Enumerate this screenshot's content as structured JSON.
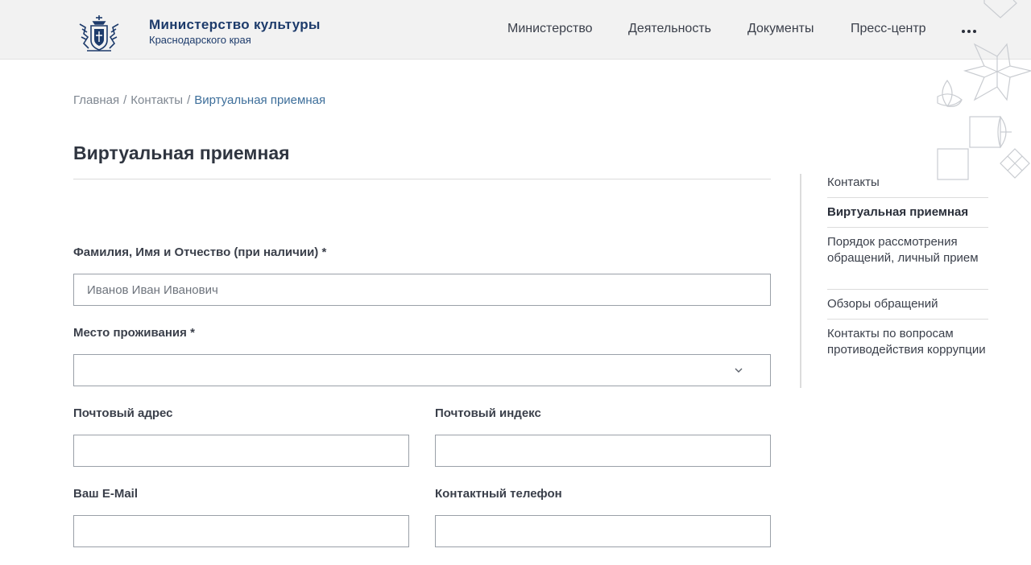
{
  "header": {
    "brand_title": "Министерство культуры",
    "brand_subtitle": "Краснодарского края",
    "nav": [
      "Министерство",
      "Деятельность",
      "Документы",
      "Пресс-центр"
    ]
  },
  "breadcrumb": {
    "home": "Главная",
    "contacts": "Контакты",
    "current": "Виртуальная приемная",
    "separator": "/"
  },
  "page": {
    "title": "Виртуальная приемная"
  },
  "form": {
    "fio_label": "Фамилия, Имя и Отчество (при наличии) *",
    "fio_placeholder": "Иванов Иван Иванович",
    "residence_label": "Место проживания *",
    "residence_value": "",
    "address_label": "Почтовый адрес",
    "index_label": "Почтовый индекс",
    "email_label": "Ваш E-Mail",
    "phone_label": "Контактный телефон"
  },
  "sidebar": {
    "items": [
      "Контакты",
      "Виртуальная приемная",
      "Порядок рассмотрения обращений, личный прием",
      "Обзоры обращений",
      "Контакты по вопросам противодействия коррупции"
    ]
  },
  "colors": {
    "brand": "#1d3b6b",
    "link_current": "#3d6e9a",
    "header_bg": "#f2f2f2"
  },
  "icons": {
    "logo": "coat-of-arms-icon",
    "more": "more-dots-icon",
    "select": "chevron-down-icon"
  }
}
